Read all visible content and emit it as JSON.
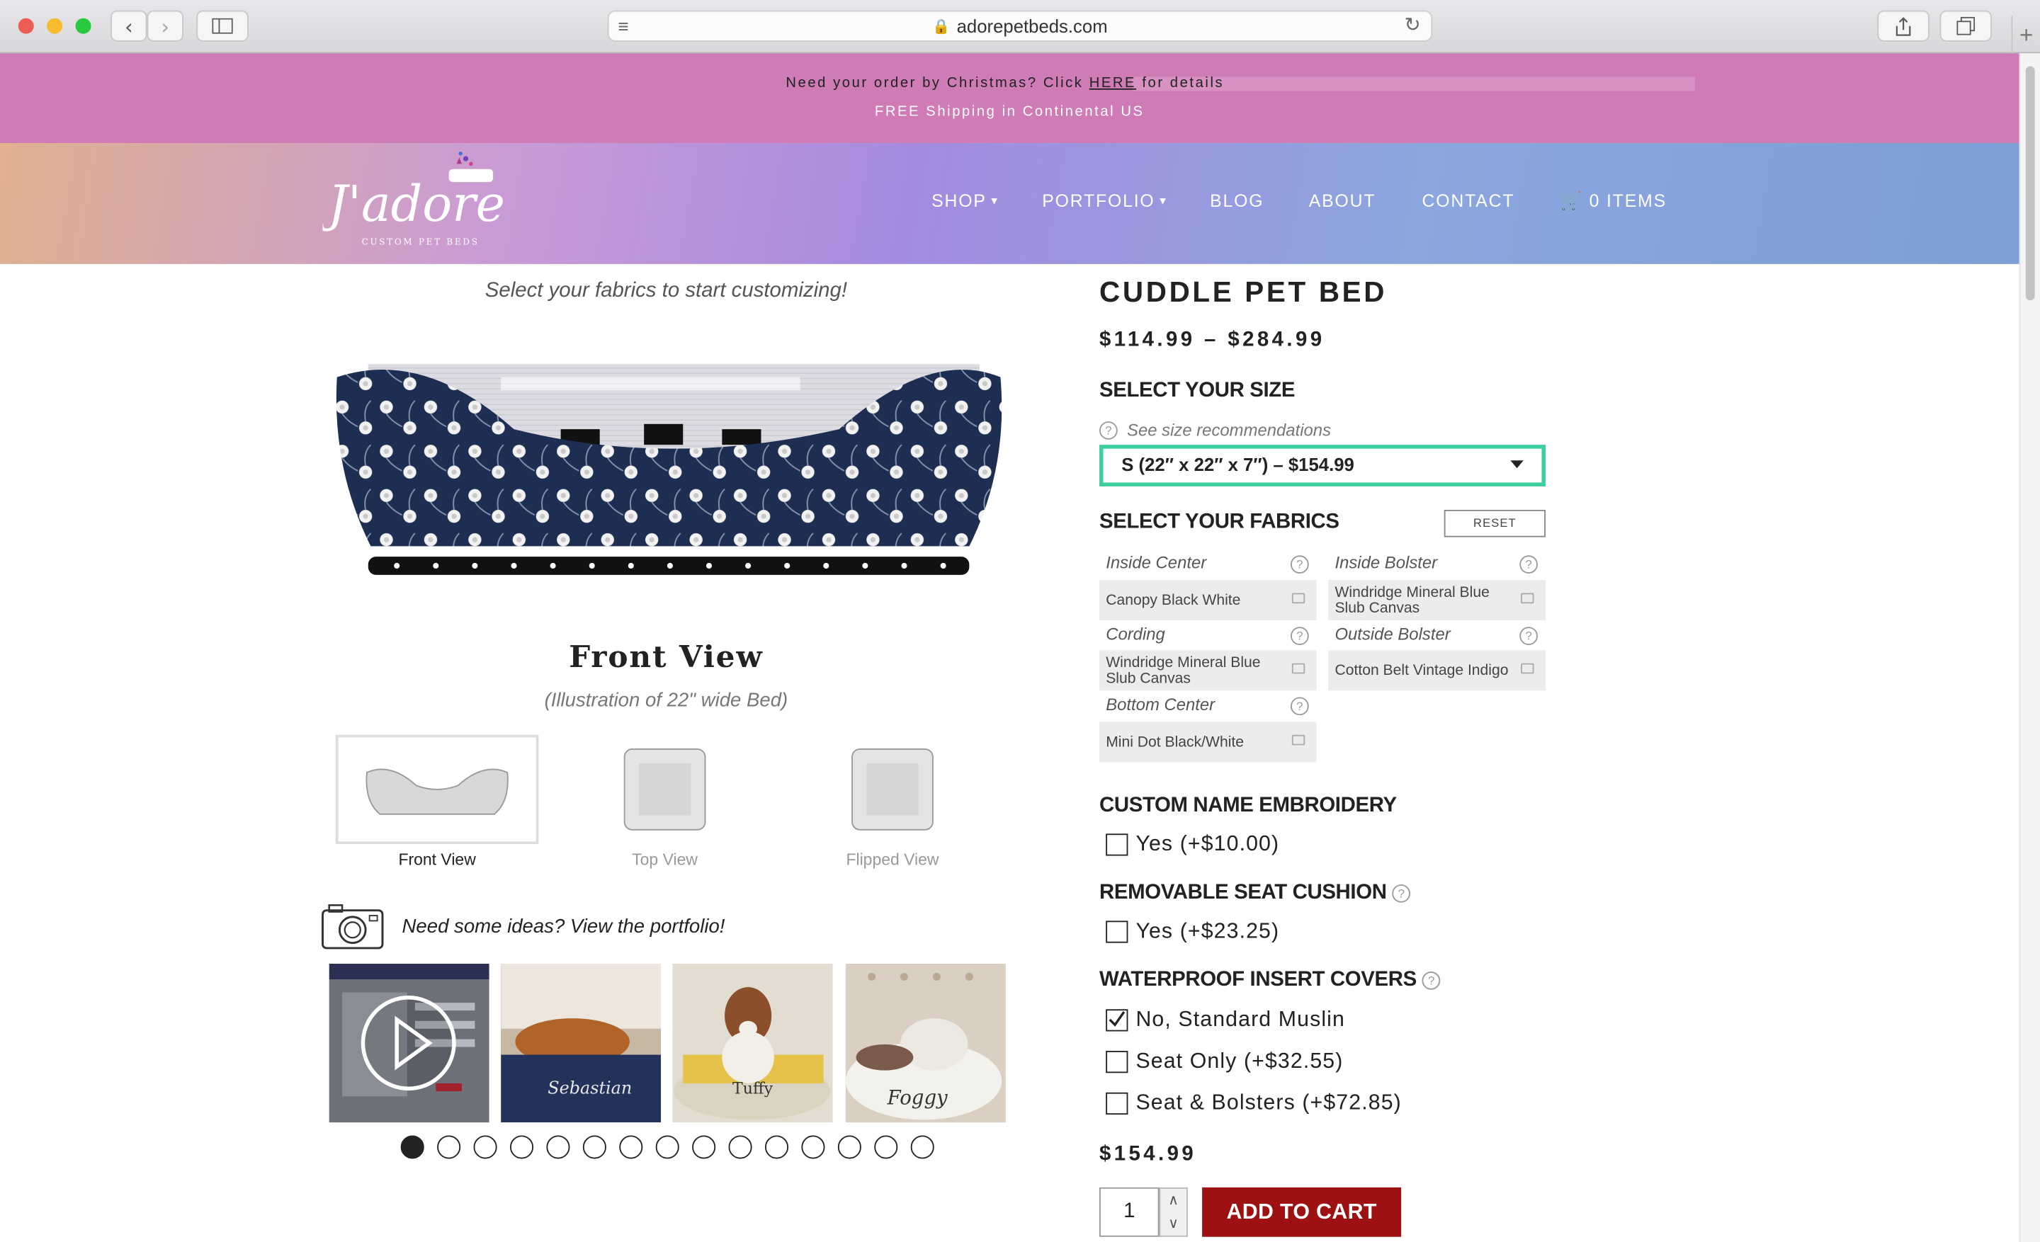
{
  "browser": {
    "url": "adorepetbeds.com",
    "colors": {
      "close": "#ee5d55",
      "minimize": "#f5bd2f",
      "maximize": "#27c93f"
    }
  },
  "promo": {
    "line1_prefix": "Need your order by Christmas?  Click",
    "line1_link": "HERE",
    "line1_suffix": "for details",
    "line2": "FREE Shipping in Continental US",
    "color": "#cf7bb6"
  },
  "brand": {
    "logo_text": "J'adore",
    "logo_sub": "CUSTOM PET BEDS"
  },
  "nav": {
    "shop": "SHOP",
    "portfolio": "PORTFOLIO",
    "blog": "BLOG",
    "about": "ABOUT",
    "contact": "CONTACT",
    "cart": "0 ITEMS"
  },
  "preview": {
    "hint": "Select your fabrics to start customizing!",
    "title": "Front View",
    "subtitle": "(Illustration of 22\" wide Bed)",
    "views": [
      {
        "label": "Front View"
      },
      {
        "label": "Top View"
      },
      {
        "label": "Flipped View"
      }
    ],
    "ideas_text": "Need some ideas? View the portfolio!",
    "thumbs": [
      {
        "caption": ""
      },
      {
        "caption": "Sebastian"
      },
      {
        "caption": "Tuffy"
      },
      {
        "caption": "Foggy"
      }
    ],
    "carousel_pages": 15,
    "carousel_active": 1
  },
  "product": {
    "title": "CUDDLE PET BED",
    "price_range": "$114.99 – $284.99",
    "size_heading": "SELECT YOUR SIZE",
    "size_rec": "See size recommendations",
    "size_selected": "S (22″ x 22″ x 7″) – $154.99",
    "fabrics_heading": "SELECT YOUR FABRICS",
    "reset": "RESET",
    "fabrics": [
      {
        "label": "Inside Center",
        "value": "Canopy Black White"
      },
      {
        "label": "Inside Bolster",
        "value": "Windridge Mineral Blue Slub Canvas"
      },
      {
        "label": "Cording",
        "value": "Windridge Mineral Blue Slub Canvas"
      },
      {
        "label": "Outside Bolster",
        "value": "Cotton Belt Vintage Indigo"
      },
      {
        "label": "Bottom Center",
        "value": "Mini Dot Black/White"
      }
    ],
    "embroidery_heading": "CUSTOM NAME EMBROIDERY",
    "embroidery_option": "Yes (+$10.00)",
    "cushion_heading": "REMOVABLE SEAT CUSHION",
    "cushion_option": "Yes (+$23.25)",
    "waterproof_heading": "WATERPROOF INSERT COVERS",
    "waterproof_options": [
      {
        "label": "No, Standard Muslin",
        "checked": true
      },
      {
        "label": "Seat Only (+$32.55)",
        "checked": false
      },
      {
        "label": "Seat & Bolsters (+$72.85)",
        "checked": false
      }
    ],
    "total": "$154.99",
    "quantity": "1",
    "add_to_cart": "ADD TO CART",
    "accent": "#3ecf9f",
    "cart_color": "#9e1112"
  }
}
